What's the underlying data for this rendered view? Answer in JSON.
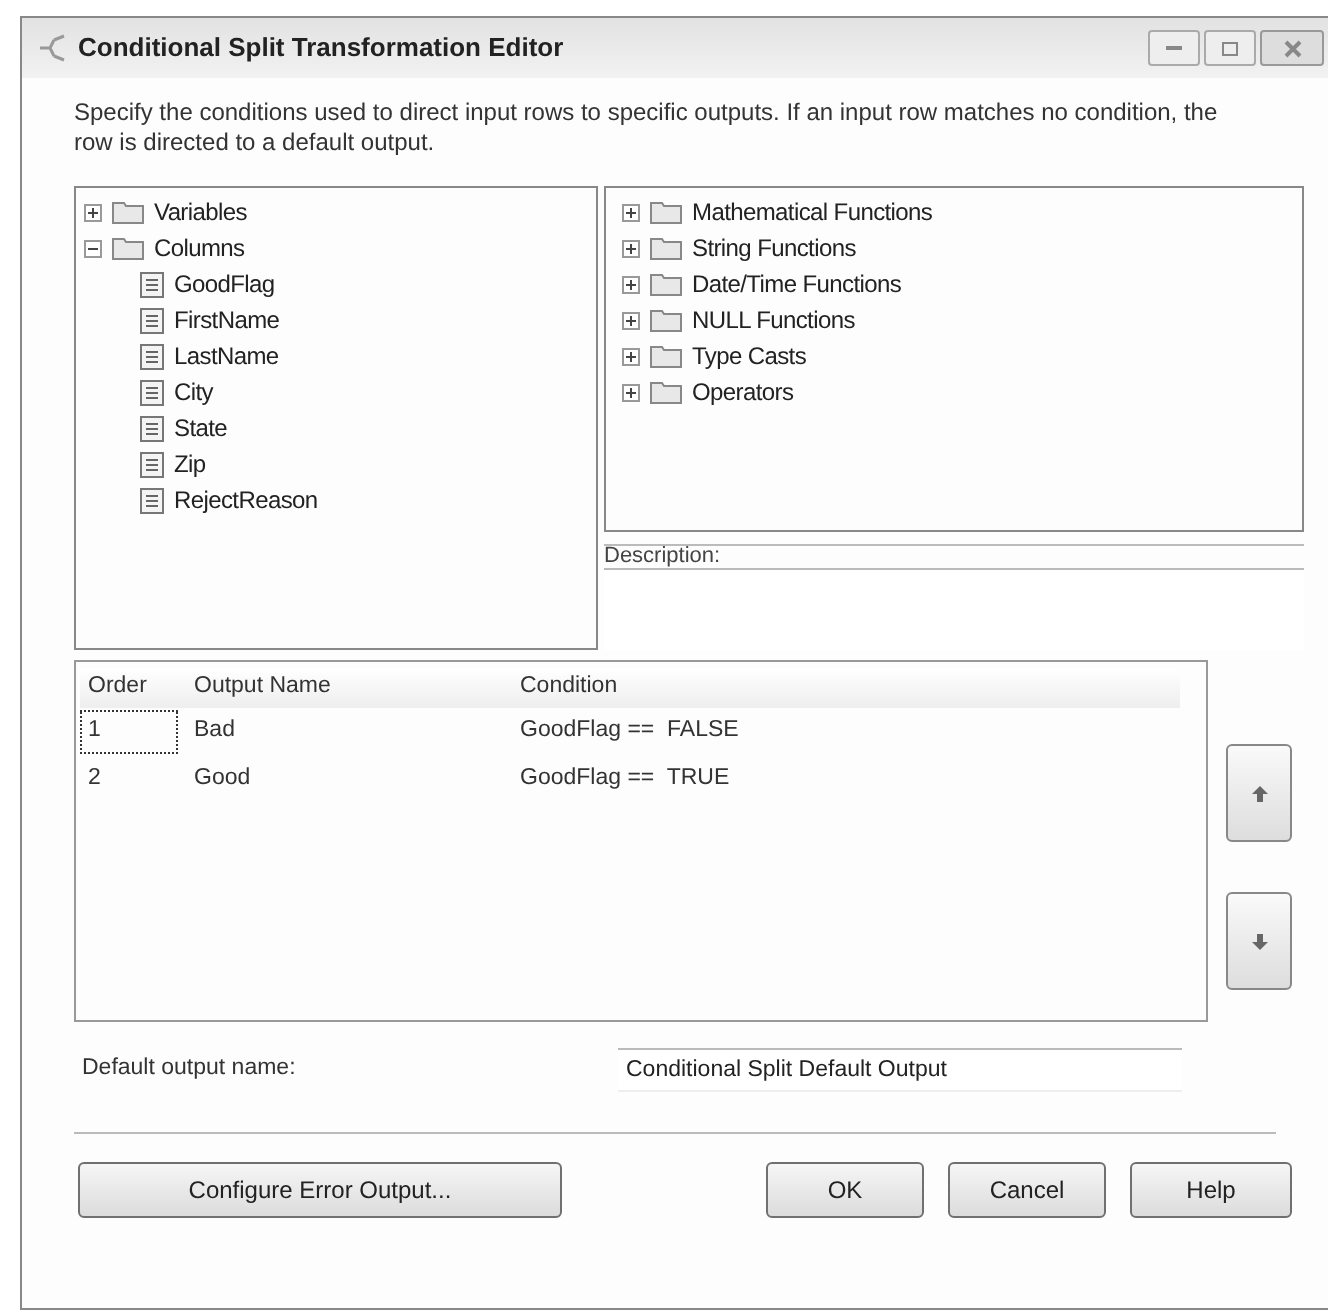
{
  "window": {
    "title": "Conditional Split Transformation Editor"
  },
  "instructions": "Specify the conditions used to direct input rows to specific outputs. If an input row matches no condition, the row is directed to a default output.",
  "input_tree": [
    {
      "label": "Variables",
      "kind": "folder",
      "expanded": false
    },
    {
      "label": "Columns",
      "kind": "folder",
      "expanded": true,
      "children": [
        {
          "label": "GoodFlag",
          "kind": "column"
        },
        {
          "label": "FirstName",
          "kind": "column"
        },
        {
          "label": "LastName",
          "kind": "column"
        },
        {
          "label": "City",
          "kind": "column"
        },
        {
          "label": "State",
          "kind": "column"
        },
        {
          "label": "Zip",
          "kind": "column"
        },
        {
          "label": "RejectReason",
          "kind": "column"
        }
      ]
    }
  ],
  "function_tree": [
    {
      "label": "Mathematical Functions",
      "kind": "folder",
      "expanded": false
    },
    {
      "label": "String Functions",
      "kind": "folder",
      "expanded": false
    },
    {
      "label": "Date/Time Functions",
      "kind": "folder",
      "expanded": false
    },
    {
      "label": "NULL Functions",
      "kind": "folder",
      "expanded": false
    },
    {
      "label": "Type Casts",
      "kind": "folder",
      "expanded": false
    },
    {
      "label": "Operators",
      "kind": "folder",
      "expanded": false
    }
  ],
  "description": {
    "label": "Description:"
  },
  "table": {
    "columns": [
      "Order",
      "Output Name",
      "Condition"
    ],
    "rows": [
      {
        "cells": [
          "1",
          "Bad",
          "GoodFlag ==  FALSE"
        ],
        "focused": true
      },
      {
        "cells": [
          "2",
          "Good",
          "GoodFlag ==  TRUE"
        ],
        "focused": false
      }
    ]
  },
  "default_output": {
    "label": "Default output name:",
    "value": "Conditional Split Default Output"
  },
  "buttons": {
    "configure": "Configure Error Output...",
    "ok": "OK",
    "cancel": "Cancel",
    "help": "Help"
  }
}
